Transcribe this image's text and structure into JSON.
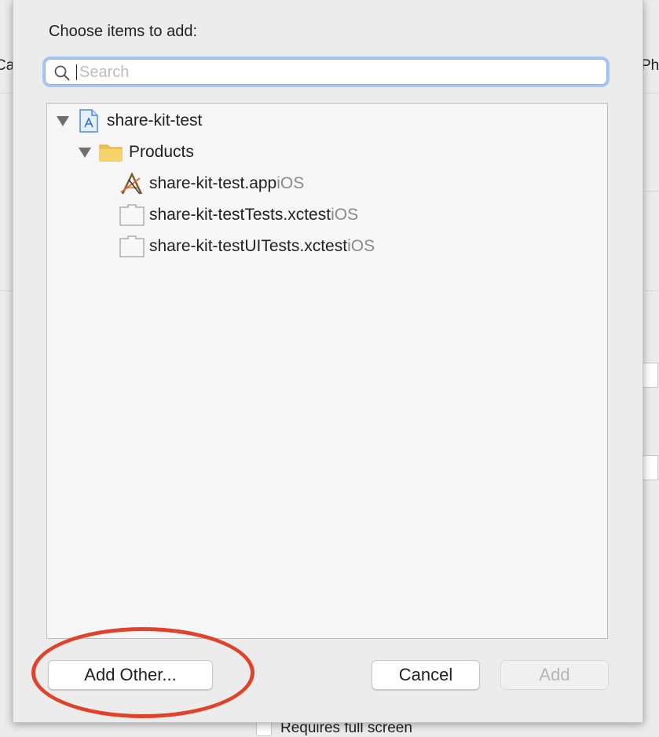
{
  "background": {
    "left_fragment": "Ca",
    "right_fragment": "Ph",
    "checkbox_label": "Requires full screen"
  },
  "dialog": {
    "title": "Choose items to add:",
    "search": {
      "placeholder": "Search",
      "value": ""
    },
    "tree": {
      "project": {
        "name": "share-kit-test",
        "icon": "xcode-project-icon",
        "expanded": true
      },
      "group": {
        "name": "Products",
        "icon": "folder-icon",
        "expanded": true
      },
      "items": [
        {
          "name": "share-kit-test.app",
          "platform": "iOS",
          "icon": "app-icon"
        },
        {
          "name": "share-kit-testTests.xctest",
          "platform": "iOS",
          "icon": "xctest-bundle-icon"
        },
        {
          "name": "share-kit-testUITests.xctest",
          "platform": "iOS",
          "icon": "xctest-bundle-icon"
        }
      ]
    },
    "buttons": {
      "add_other": "Add Other...",
      "cancel": "Cancel",
      "add": "Add"
    },
    "annotation_color": "#e0432b"
  }
}
